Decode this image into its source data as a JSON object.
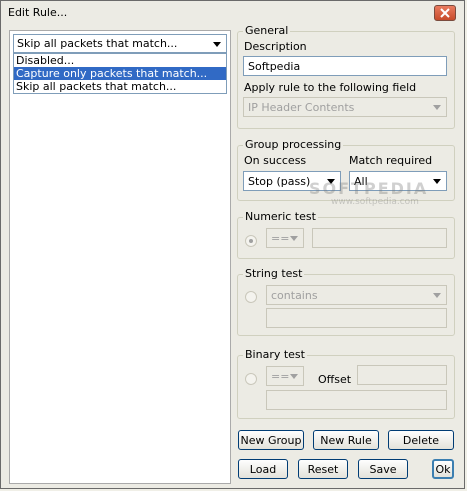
{
  "window": {
    "title": "Edit Rule...",
    "close_label": "close"
  },
  "rule_action": {
    "selected": "Skip all packets that match...",
    "options": [
      "Disabled...",
      "Capture only packets that match...",
      "Skip all packets that match..."
    ],
    "highlighted_index": 1
  },
  "general": {
    "legend": "General",
    "description_label": "Description",
    "description_value": "Softpedia",
    "apply_label": "Apply rule to the following field",
    "apply_value": "IP Header Contents"
  },
  "group_processing": {
    "legend": "Group processing",
    "on_success_label": "On success",
    "on_success_value": "Stop (pass)",
    "match_required_label": "Match required",
    "match_required_value": "All"
  },
  "numeric_test": {
    "legend": "Numeric test",
    "operator": "==",
    "value": ""
  },
  "string_test": {
    "legend": "String test",
    "operator": "contains",
    "value": ""
  },
  "binary_test": {
    "legend": "Binary test",
    "operator": "==",
    "offset_label": "Offset",
    "offset_value": "",
    "value": ""
  },
  "buttons": {
    "new_group": "New Group",
    "new_rule": "New Rule",
    "delete": "Delete",
    "load": "Load",
    "reset": "Reset",
    "save": "Save",
    "ok": "Ok"
  },
  "watermark": {
    "text": "SOFTPEDIA",
    "url": "www.softpedia.com"
  }
}
